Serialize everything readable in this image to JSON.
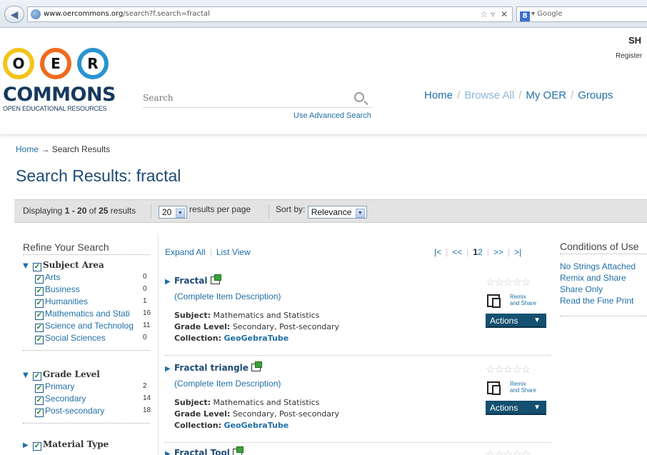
{
  "browser": {
    "url_host": "www.oercommons.org",
    "url_path": "/search?f.search=fractal",
    "search_engine": "Google"
  },
  "header": {
    "logo_letters": [
      "O",
      "E",
      "R"
    ],
    "logo_word": "COMMONS",
    "logo_sub": "OPEN EDUCATIONAL RESOURCES",
    "search_placeholder": "Search",
    "advanced_search": "Use Advanced Search",
    "nav": [
      "Home",
      "Browse All",
      "My OER",
      "Groups"
    ],
    "separator": "/",
    "user_short": "SH",
    "register": "Register"
  },
  "breadcrumb": {
    "home": "Home",
    "arrow": "→",
    "current": "Search Results"
  },
  "page_title": "Search Results: fractal",
  "toolbar": {
    "displaying_prefix": "Displaying",
    "range": "1 - 20",
    "of": "of",
    "total": "25",
    "results_word": "results",
    "per_page_value": "20",
    "per_page_label": "results per page",
    "sort_label": "Sort by:",
    "sort_value": "Relevance"
  },
  "refine": {
    "title": "Refine Your Search",
    "facets": [
      {
        "name": "Subject Area",
        "items": [
          {
            "label": "Arts",
            "count": "0"
          },
          {
            "label": "Business",
            "count": "0"
          },
          {
            "label": "Humanities",
            "count": "1"
          },
          {
            "label": "Mathematics and Stati",
            "count": "16"
          },
          {
            "label": "Science and Technolog",
            "count": "11"
          },
          {
            "label": "Social Sciences",
            "count": "0"
          }
        ]
      },
      {
        "name": "Grade Level",
        "items": [
          {
            "label": "Primary",
            "count": "2"
          },
          {
            "label": "Secondary",
            "count": "14"
          },
          {
            "label": "Post-secondary",
            "count": "18"
          }
        ]
      },
      {
        "name": "Material Type",
        "items": []
      }
    ]
  },
  "list_controls": {
    "expand_all": "Expand All",
    "list_view": "List View"
  },
  "pager": {
    "first": "|<",
    "prev": "<<",
    "page1": "1",
    "page2": "2",
    "next": ">>",
    "last": ">|"
  },
  "results": [
    {
      "title": "Fractal",
      "desc_link": "(Complete Item Description)",
      "subject_label": "Subject:",
      "subject": "Mathematics and Statistics",
      "grade_label": "Grade Level:",
      "grade": "Secondary, Post-secondary",
      "collection_label": "Collection:",
      "collection": "GeoGebraTube",
      "stars": "☆☆☆☆☆",
      "remix_line1": "Remix",
      "remix_line2": "and Share",
      "actions": "Actions",
      "actions_caret": "▼"
    },
    {
      "title": "Fractal triangle",
      "desc_link": "(Complete Item Description)",
      "subject_label": "Subject:",
      "subject": "Mathematics and Statistics",
      "grade_label": "Grade Level:",
      "grade": "Secondary, Post-secondary",
      "collection_label": "Collection:",
      "collection": "GeoGebraTube",
      "stars": "☆☆☆☆☆",
      "remix_line1": "Remix",
      "remix_line2": "and Share",
      "actions": "Actions",
      "actions_caret": "▼"
    },
    {
      "title": "Fractal Tool",
      "stars": "☆☆☆☆☆"
    }
  ],
  "conditions": {
    "title": "Conditions of Use",
    "items": [
      "No Strings Attached",
      "Remix and Share",
      "Share Only",
      "Read the Fine Print"
    ]
  },
  "colors": {
    "link": "#1f6fa6",
    "title": "#1d4a73",
    "actions_bg": "#14506f",
    "logo_yellow": "#f3c317",
    "logo_orange": "#ee6a1d",
    "logo_blue": "#2a94cf"
  }
}
